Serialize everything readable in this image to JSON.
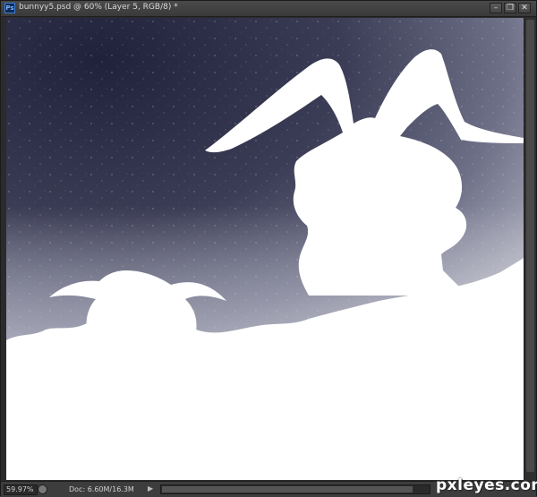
{
  "window": {
    "title": "bunnyy5.psd @ 60% (Layer 5, RGB/8) *",
    "app_icon": "Ps",
    "buttons": {
      "minimize": "–",
      "restore": "❐",
      "close": "✕"
    }
  },
  "status": {
    "zoom": "59.97%",
    "doc_info": "Doc: 6.60M/16.3M"
  },
  "watermark": "pxleyes.com",
  "colors": {
    "sky_dark": "#23243a",
    "sky_mid": "#5e6078",
    "sky_light": "#b3b3c0",
    "silhouette": "#ffffff",
    "chrome": "#3c3c3c"
  }
}
